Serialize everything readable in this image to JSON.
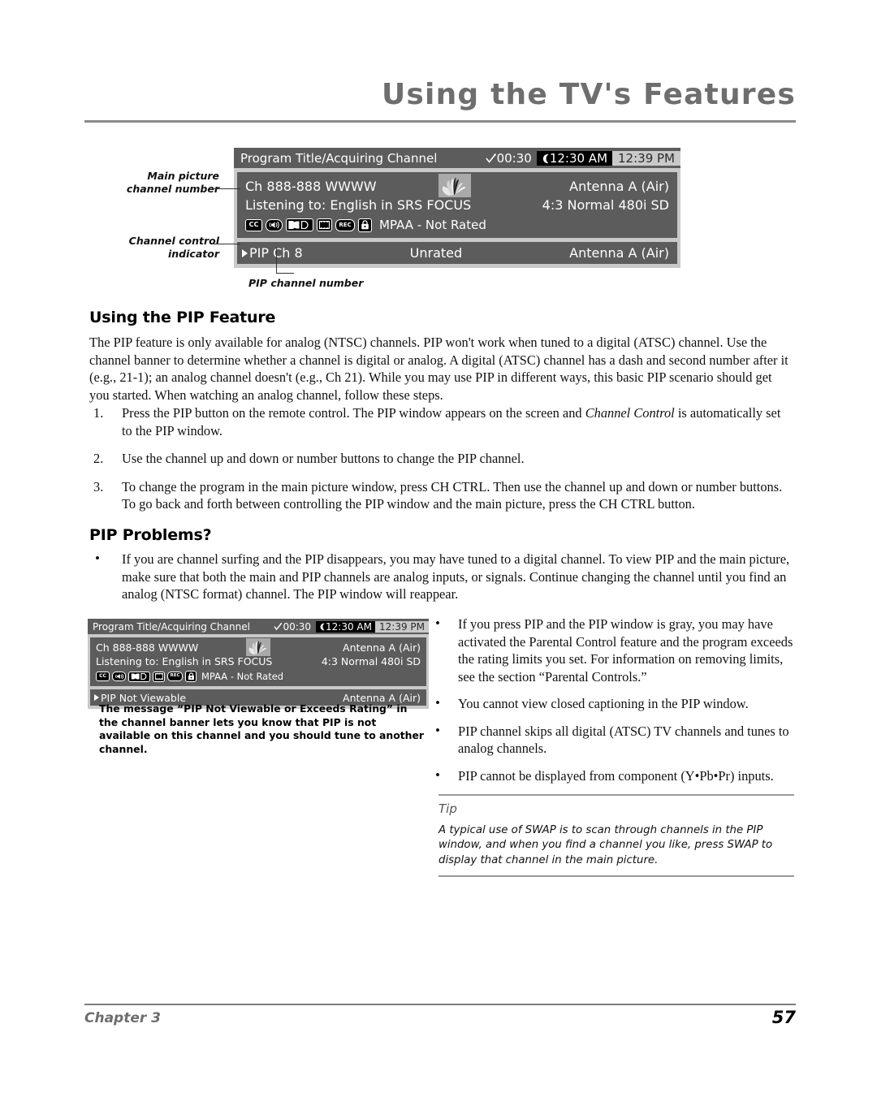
{
  "header": {
    "title": "Using the TV's Features"
  },
  "banner_top": {
    "program_title": "Program Title/Acquiring Channel",
    "sleep_timer": "00:30",
    "timer_clock": "12:30 AM",
    "clock": "12:39 PM",
    "channel": "Ch 888-888 WWWW",
    "audio": "Listening to: English in SRS FOCUS",
    "rating": "MPAA - Not Rated",
    "source": "Antenna A (Air)",
    "format": "4:3 Normal 480i SD",
    "pip_channel": "PIP Ch 8",
    "pip_rating": "Unrated",
    "pip_source": "Antenna A (Air)",
    "icons": [
      "cc-icon",
      "audio-icon",
      "dolby-digital-icon",
      "film-frame-icon",
      "rec-icon",
      "lock-icon"
    ],
    "logo": "peacock-logo"
  },
  "callouts": {
    "main_channel": "Main picture\nchannel number",
    "channel_control": "Channel control\nindicator",
    "pip_channel": "PIP channel number"
  },
  "section_pip": {
    "heading": "Using the PIP Feature",
    "intro": "The PIP feature is only available for analog (NTSC) channels. PIP won't work when tuned to a digital (ATSC) channel. Use the channel banner to determine whether a channel is digital or analog. A digital (ATSC) channel has a dash and second number after it (e.g., 21-1); an analog channel doesn't (e.g., Ch 21). While you may use PIP in different ways, this basic PIP scenario should get you started. When watching an analog channel, follow these steps.",
    "steps": [
      {
        "num": "1.",
        "pre": "Press the PIP button on the remote control. The PIP window appears on the screen and ",
        "em": "Channel Control",
        "post": " is automatically set to the PIP window."
      },
      {
        "num": "2.",
        "pre": "Use the channel up and down or number buttons to change the PIP channel.",
        "em": "",
        "post": ""
      },
      {
        "num": "3.",
        "pre": "To change the program in the main picture window, press CH CTRL. Then use the channel up and down or number buttons. To go back and forth between controlling the PIP window and the main picture, press the CH CTRL button.",
        "em": "",
        "post": ""
      }
    ]
  },
  "section_problems": {
    "heading": "PIP Problems?",
    "bullet_left": "If you are channel surfing and the PIP disappears, you may have tuned to a digital channel. To view PIP and the main picture, make sure that both the main and PIP channels are analog inputs, or signals. Continue changing the channel until you find an analog (NTSC format) channel. The PIP window will reappear.",
    "bullets_right": [
      "If you press PIP and the PIP window is gray, you may have activated the Parental Control feature and the program exceeds the rating limits you set. For information on removing limits, see the section “Parental Controls.”",
      "You cannot view closed captioning in the PIP window.",
      "PIP channel skips all digital (ATSC) TV channels and tunes to analog channels.",
      "PIP cannot be displayed from component (Y•Pb•Pr) inputs."
    ]
  },
  "banner_bottom": {
    "program_title": "Program Title/Acquiring Channel",
    "sleep_timer": "00:30",
    "timer_clock": "12:30 AM",
    "clock": "12:39 PM",
    "channel": "Ch 888-888 WWWW",
    "audio": "Listening to: English in SRS FOCUS",
    "rating": "MPAA - Not Rated",
    "source": "Antenna A (Air)",
    "format": "4:3 Normal 480i SD",
    "pip_channel": "PIP Not Viewable",
    "pip_source": "Antenna A (Air)",
    "caption": "The message “PIP Not Viewable or Exceeds Rating” in the channel banner lets you know that PIP is not available on this channel and you should tune to another channel."
  },
  "tip": {
    "label": "Tip",
    "text": "A typical use of SWAP is to scan through channels in the PIP window, and when you find a channel you like, press SWAP to display that channel in the main picture."
  },
  "footer": {
    "chapter": "Chapter 3",
    "page": "57"
  },
  "colors": {
    "banner_dark": "#5c5c5c",
    "banner_light": "#c9c9c9",
    "title_gray": "#6e6e6e"
  }
}
